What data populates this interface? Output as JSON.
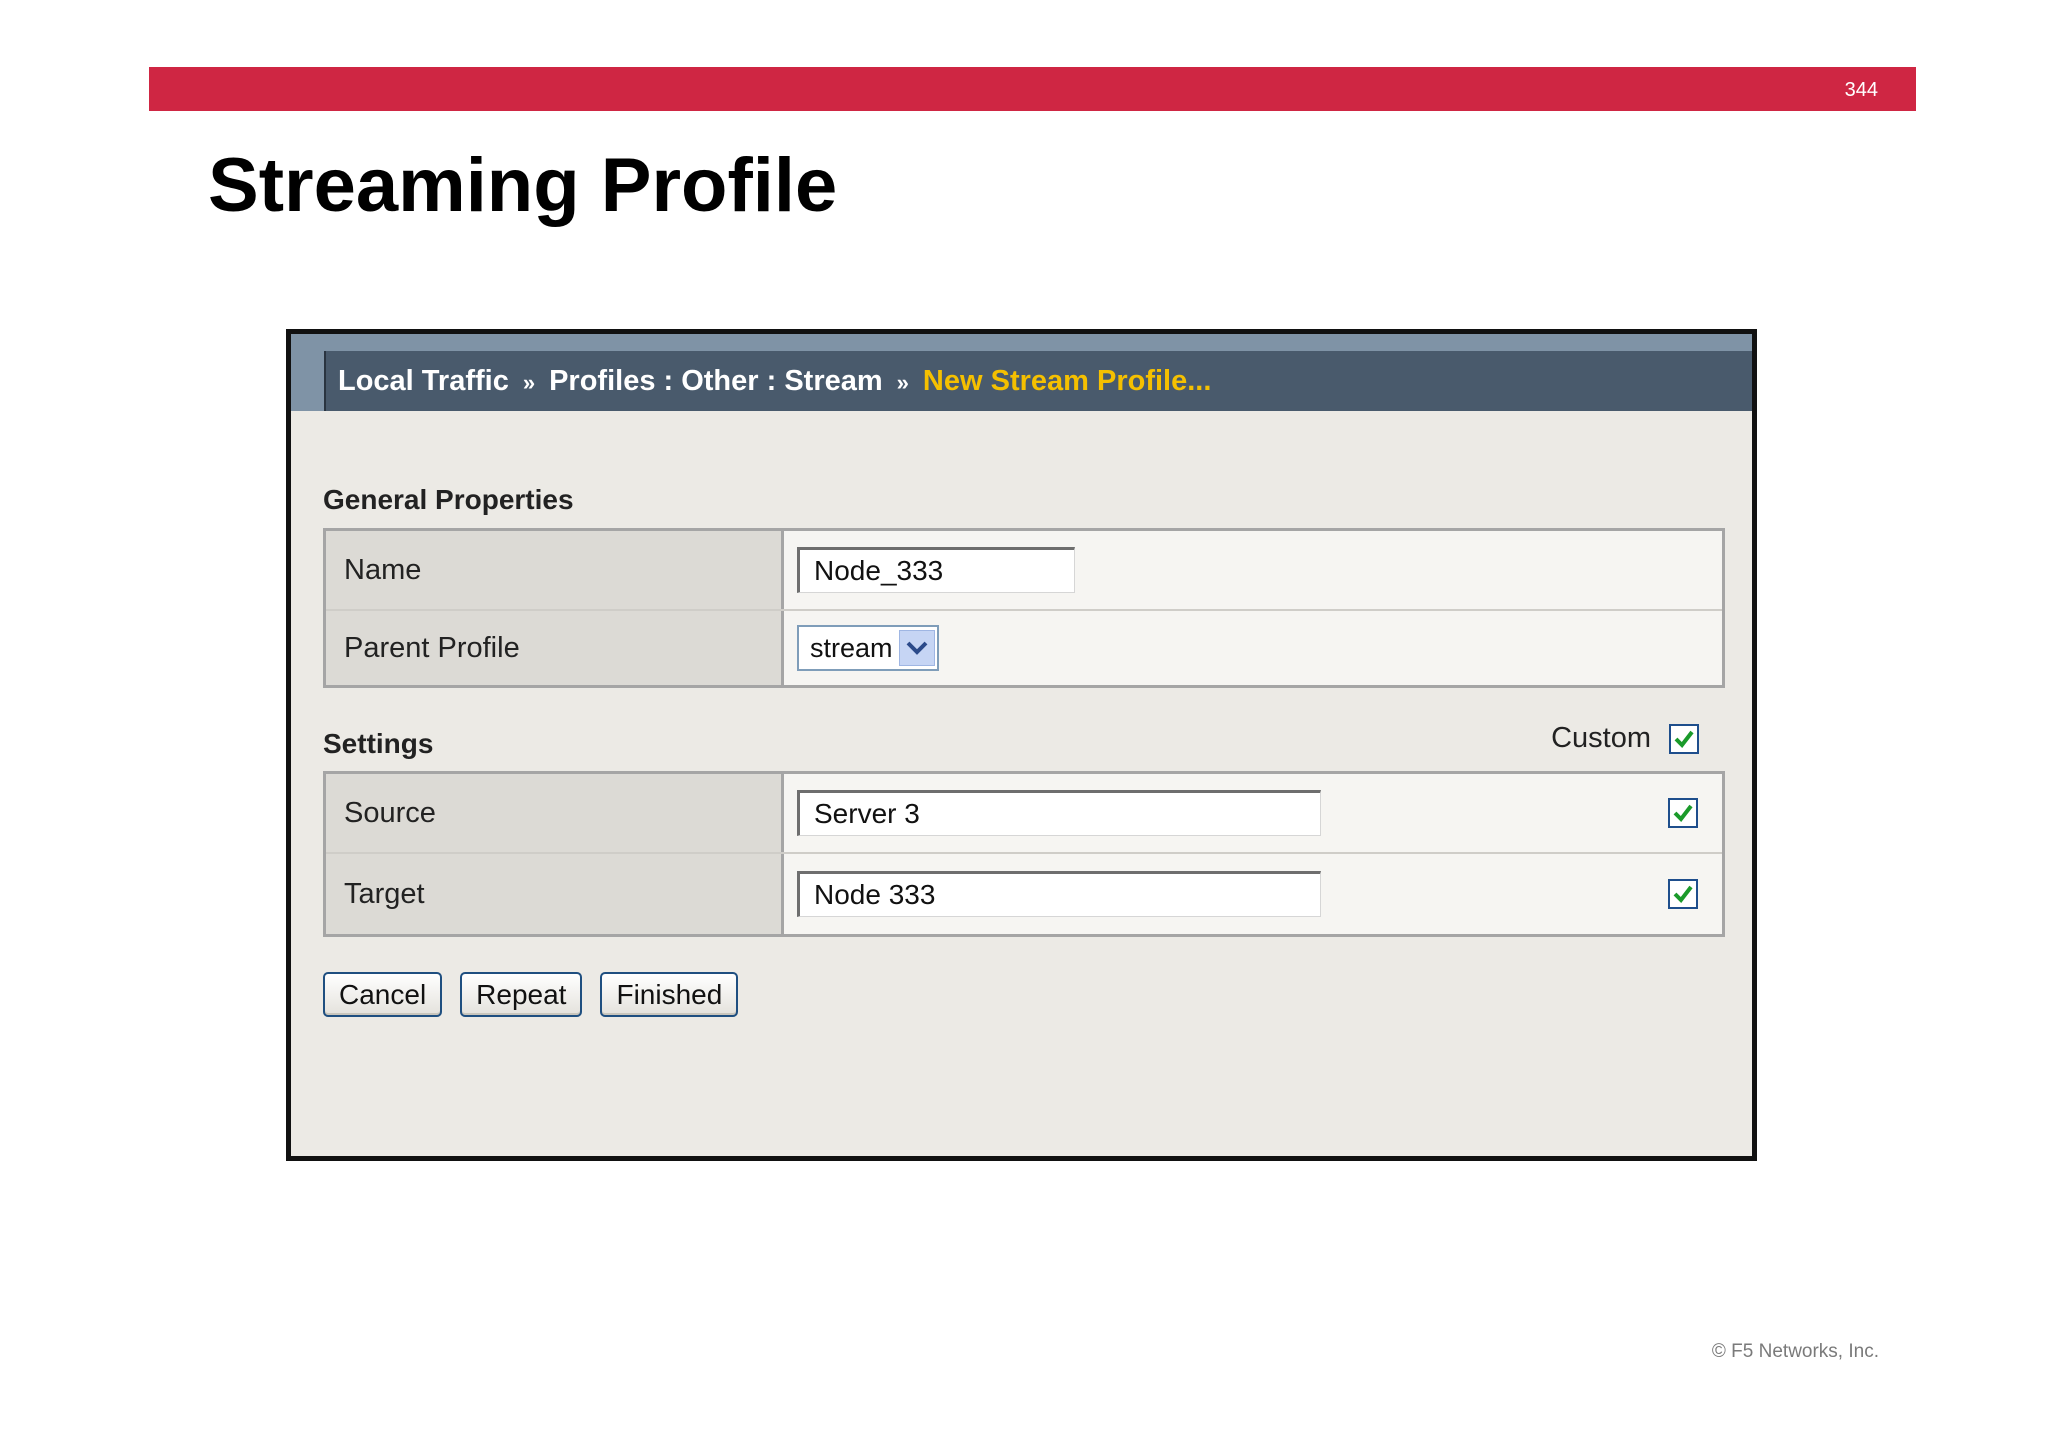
{
  "slide": {
    "page_number": "344",
    "title": "Streaming Profile",
    "copyright": "© F5 Networks, Inc."
  },
  "breadcrumb": {
    "item_1": "Local Traffic",
    "item_2": "Profiles : Other : Stream",
    "current": "New Stream Profile...",
    "separator": "»"
  },
  "general": {
    "section_title": "General Properties",
    "name_label": "Name",
    "name_value": "Node_333",
    "parent_label": "Parent Profile",
    "parent_value": "stream"
  },
  "settings": {
    "section_title": "Settings",
    "custom_label": "Custom",
    "custom_checked": true,
    "source_label": "Source",
    "source_value": "Server 3",
    "source_checked": true,
    "target_label": "Target",
    "target_value": "Node 333",
    "target_checked": true
  },
  "buttons": {
    "cancel": "Cancel",
    "repeat": "Repeat",
    "finished": "Finished"
  },
  "colors": {
    "brand_red": "#cf2643",
    "breadcrumb_current": "#f5c000",
    "check_green": "#1a9a2a"
  }
}
